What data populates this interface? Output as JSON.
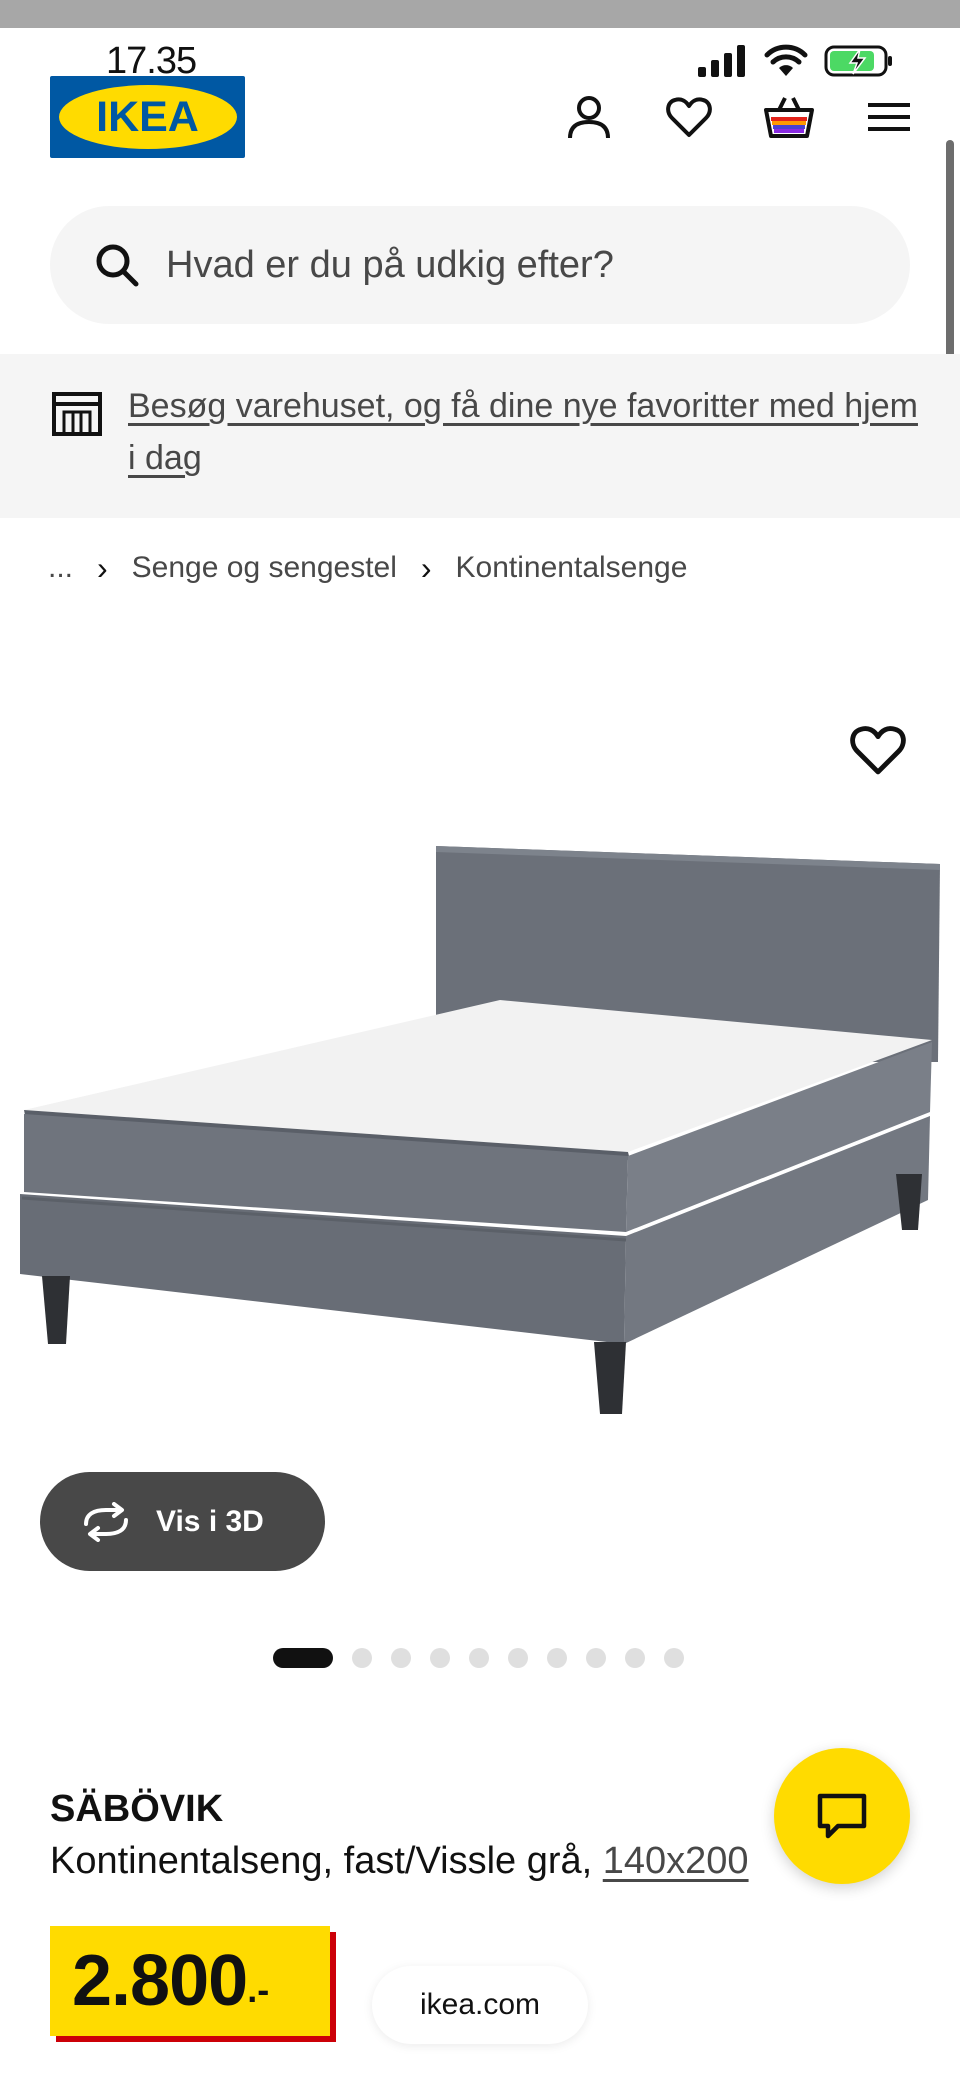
{
  "status_bar": {
    "time": "17.35"
  },
  "header": {
    "logo_text": "IKEA"
  },
  "search": {
    "placeholder": "Hvad er du på udkig efter?"
  },
  "store_banner": {
    "link_text": "Besøg varehuset, og få dine nye favoritter med hjem i dag"
  },
  "breadcrumb": {
    "ellipsis": "...",
    "items": [
      "Senge og sengestel",
      "Kontinentalsenge"
    ]
  },
  "product": {
    "name": "SÄBÖVIK",
    "description": "Kontinentalseng, fast/Vissle grå, ",
    "size_link": "140x200",
    "price": "2.800",
    "price_suffix": ".-"
  },
  "gallery": {
    "view_3d_label": "Vis i 3D",
    "dot_count": 10,
    "active_index": 0
  },
  "browser": {
    "url": "ikea.com"
  },
  "icons": {
    "account": "person-icon",
    "favorites": "heart-icon",
    "cart": "shopping-bag-icon",
    "menu": "hamburger-icon",
    "chat": "chat-bubble-icon",
    "store": "store-icon",
    "search": "search-icon",
    "rotate": "rotate-3d-icon"
  },
  "colors": {
    "brand_blue": "#0058a3",
    "brand_yellow": "#ffdb00",
    "price_shadow_red": "#cc0008"
  }
}
